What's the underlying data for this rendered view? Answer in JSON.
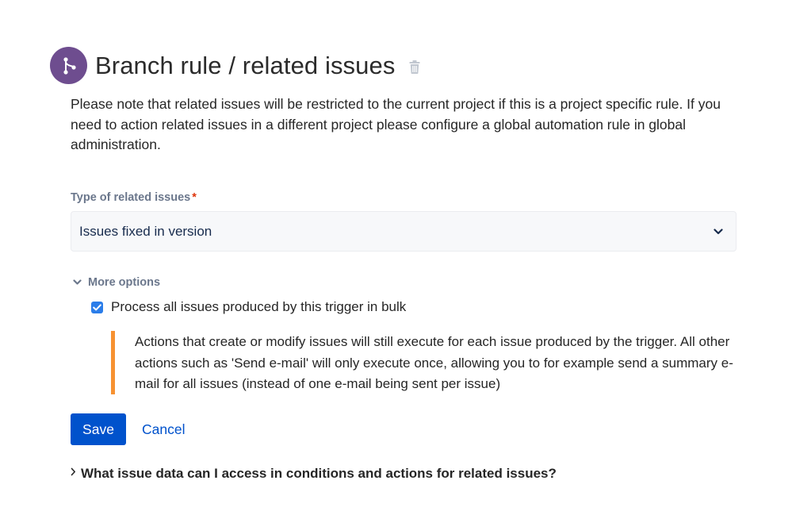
{
  "header": {
    "title": "Branch rule / related issues",
    "icon": "branch-icon",
    "icon_bg_color": "#6e4d8f",
    "delete_icon": "trash-icon"
  },
  "description": "Please note that related issues will be restricted to the current project if this is a project specific rule. If you need to action related issues in a different project please configure a global automation rule in global administration.",
  "related_issues_field": {
    "label": "Type of related issues",
    "required_marker": "*",
    "value": "Issues fixed in version",
    "icon": "chevron-down-icon"
  },
  "more_options": {
    "label": "More options",
    "expanded": true,
    "bulk_checkbox": {
      "label": "Process all issues produced by this trigger in bulk",
      "checked": true
    },
    "note": "Actions that create or modify issues will still execute for each issue produced by the trigger. All other actions such as 'Send e-mail' will only execute once, allowing you to for example send a summary e-mail for all issues (instead of one e-mail being sent per issue)",
    "note_accent_color": "#f79232"
  },
  "actions": {
    "save_label": "Save",
    "cancel_label": "Cancel",
    "primary_color": "#0052cc"
  },
  "faq": {
    "label": "What issue data can I access in conditions and actions for related issues?",
    "icon": "chevron-right-icon"
  }
}
